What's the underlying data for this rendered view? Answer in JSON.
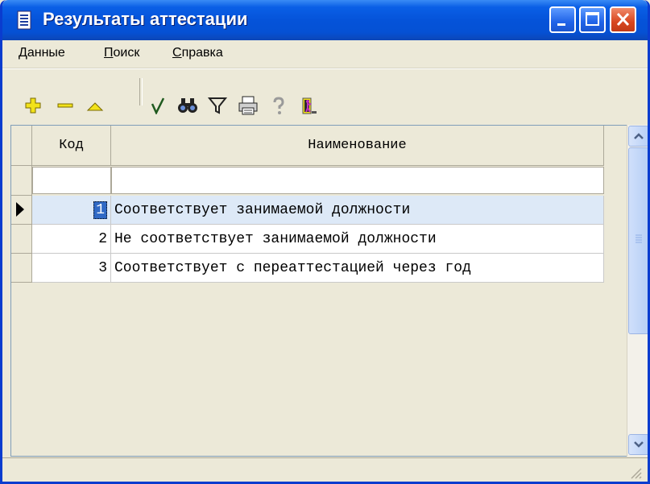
{
  "window": {
    "title": "Результаты аттестации",
    "controls": [
      "minimize",
      "maximize",
      "close"
    ]
  },
  "menu": [
    {
      "label": "Данные",
      "mnemonic": "Д",
      "rest": "анные"
    },
    {
      "label": "Поиск",
      "mnemonic": "П",
      "rest": "оиск"
    },
    {
      "label": "Справка",
      "mnemonic": "С",
      "rest": "правка"
    }
  ],
  "toolbar": {
    "icons": [
      "add-icon",
      "delete-icon",
      "edit-icon",
      "confirm-icon",
      "find-icon",
      "filter-icon",
      "print-icon",
      "help-icon",
      "exit-icon"
    ]
  },
  "grid": {
    "headers": {
      "code": "Код",
      "name": "Наименование"
    },
    "filter": {
      "code": "",
      "name": ""
    },
    "selected_row": 0,
    "rows": [
      {
        "code": "1",
        "name": "Соответствует занимаемой должности"
      },
      {
        "code": "2",
        "name": "Не соответствует занимаемой должности"
      },
      {
        "code": "3",
        "name": "Соответствует с переаттестацией через год"
      }
    ]
  },
  "colors": {
    "titlebar": "#0553d9",
    "selection": "#316ac5",
    "selected_row_bg": "#dde9f7"
  }
}
